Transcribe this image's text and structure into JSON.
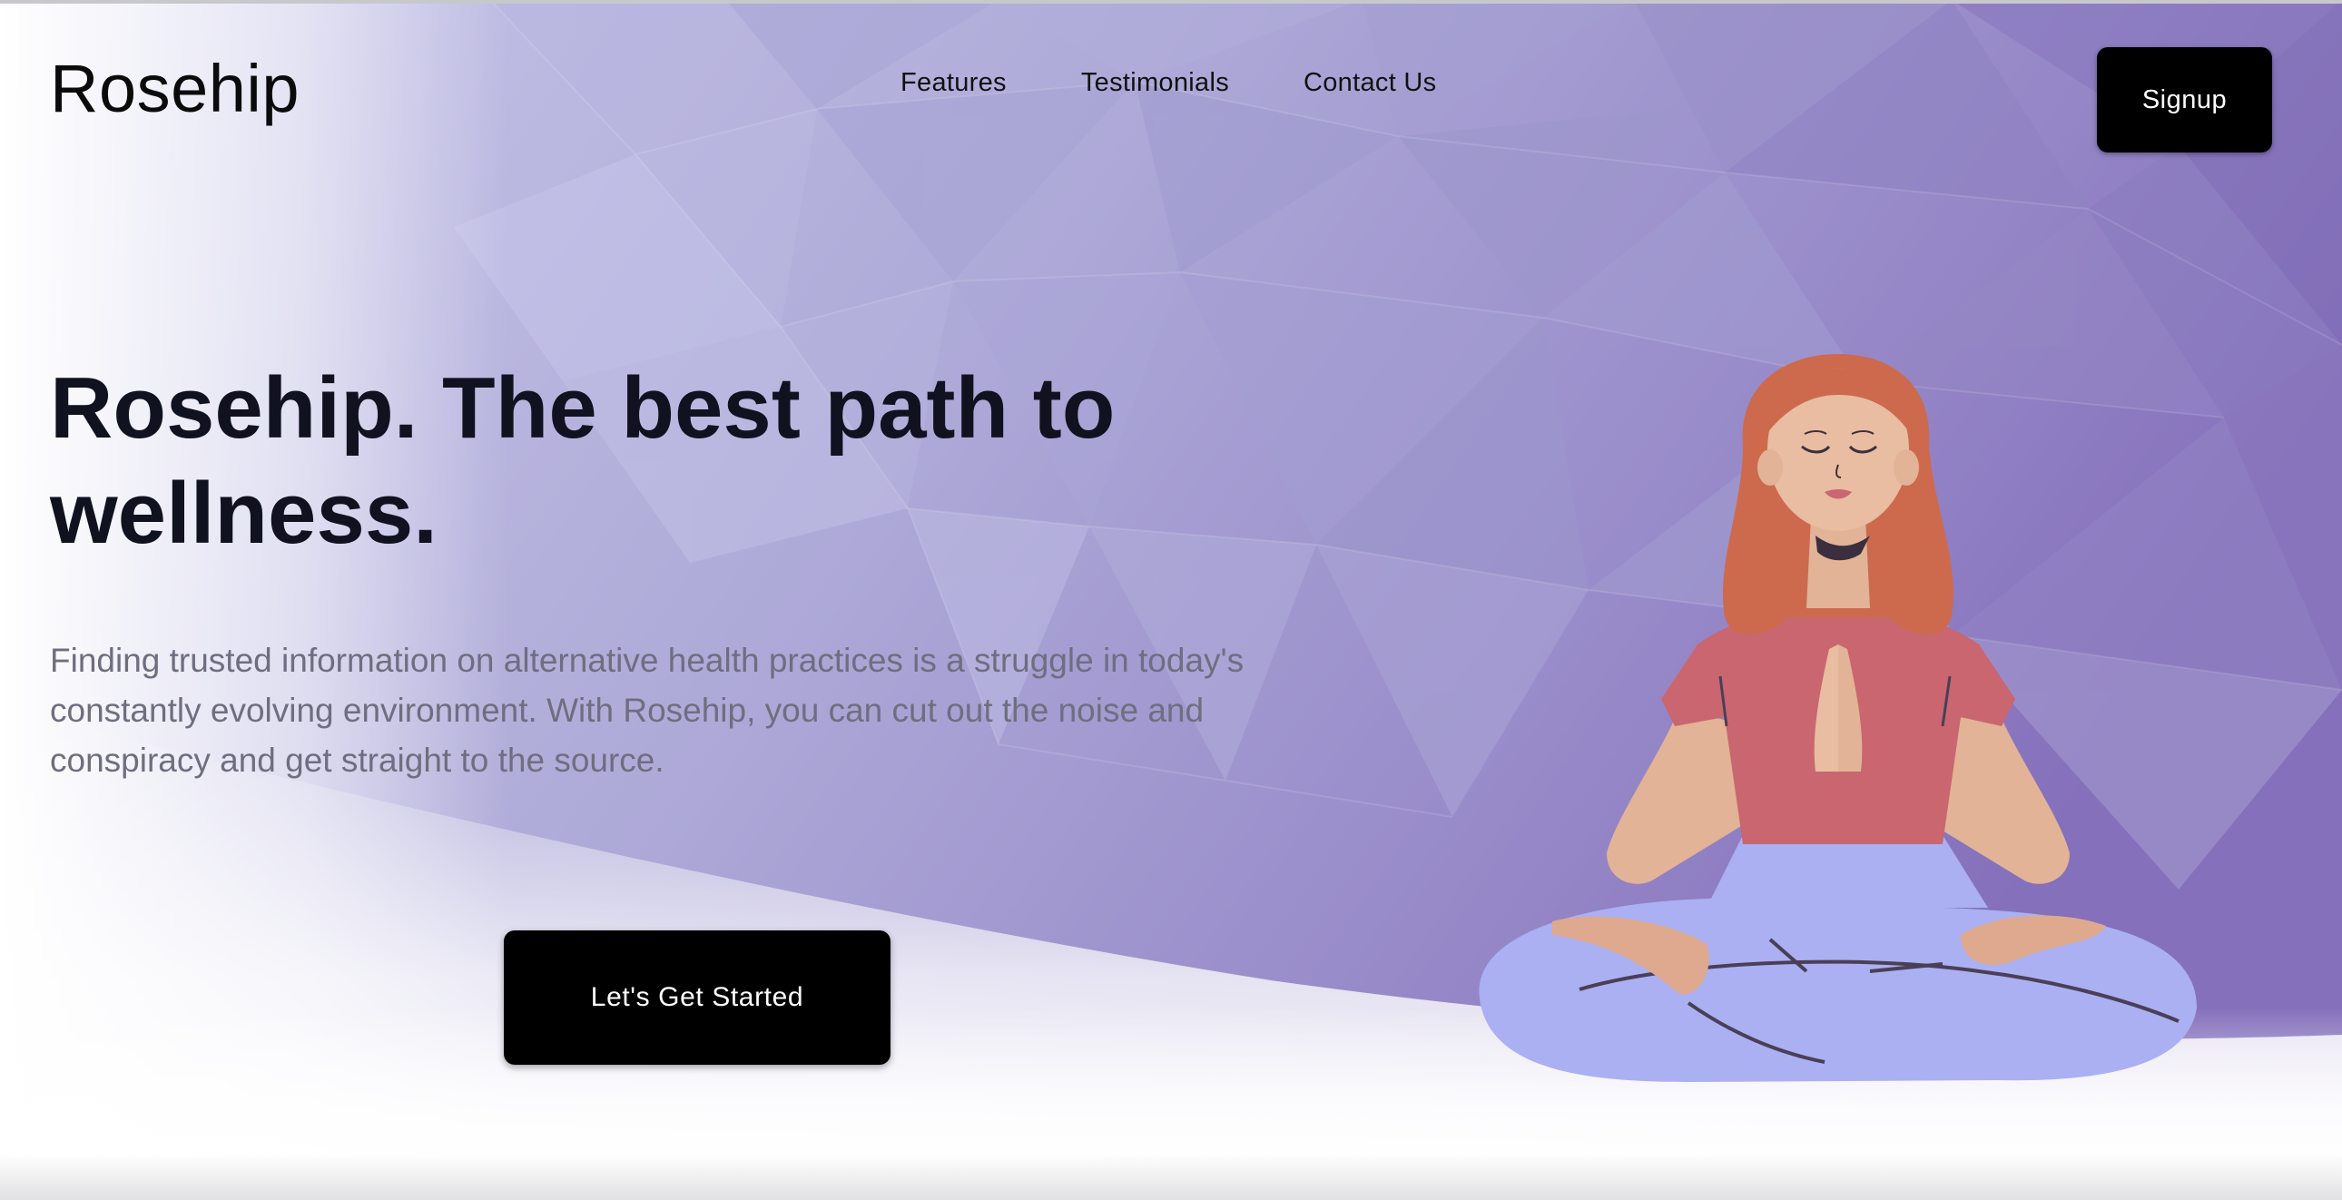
{
  "brand": {
    "name": "Rosehip"
  },
  "nav": {
    "items": [
      {
        "label": "Features"
      },
      {
        "label": "Testimonials"
      },
      {
        "label": "Contact Us"
      }
    ]
  },
  "header": {
    "signup_label": "Signup"
  },
  "hero": {
    "title": "Rosehip. The best path to wellness.",
    "description": "Finding trusted information on alternative health practices is a struggle in today's constantly evolving environment. With Rosehip, you can cut out the noise and conspiracy and get straight to the source.",
    "cta_label": "Let's Get Started",
    "illustration": "meditating-woman-illustration"
  },
  "colors": {
    "background_accent": "#8e7fc4",
    "button": "#000000",
    "button_text": "#ffffff",
    "title": "#11121f",
    "description": "#6f6e80"
  }
}
